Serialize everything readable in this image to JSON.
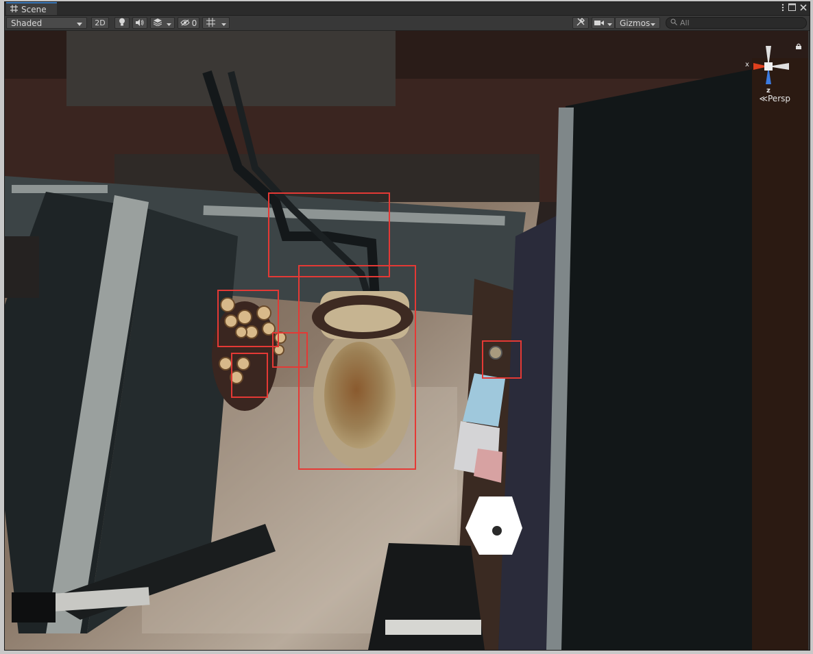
{
  "window": {
    "tab_title": "Scene"
  },
  "toolbar": {
    "draw_mode": "Shaded",
    "mode_2d": "2D",
    "hidden_count": "0",
    "gizmos_label": "Gizmos",
    "search_placeholder": "All"
  },
  "viewport": {
    "projection_label": "Persp",
    "axis_x": "x",
    "axis_z": "z",
    "detections": [
      {
        "label": "pipe"
      },
      {
        "label": "toilet"
      },
      {
        "label": "toilet-paper-rolls"
      },
      {
        "label": "toilet-paper-roll"
      },
      {
        "label": "toilet-paper-roll"
      },
      {
        "label": "flush-button"
      }
    ]
  },
  "colors": {
    "bbox": "#e53935",
    "tab_accent": "#3a79bb",
    "toolbar_bg": "#383838"
  }
}
